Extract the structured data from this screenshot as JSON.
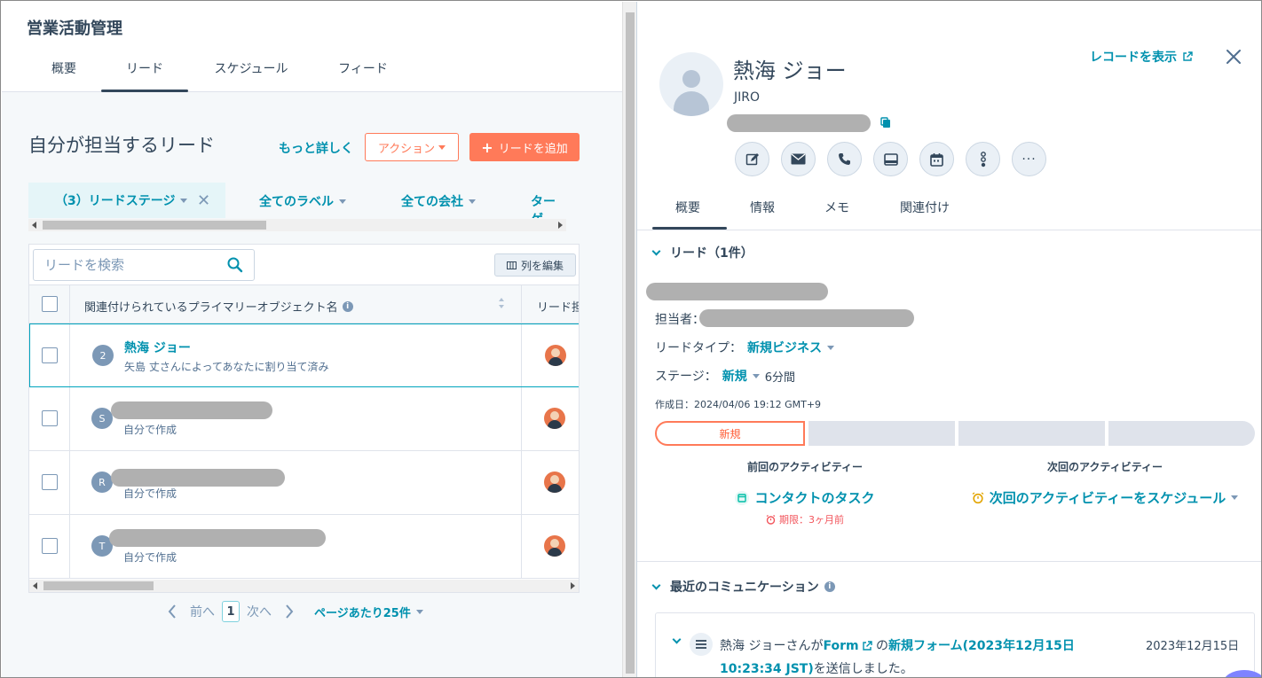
{
  "app": {
    "title": "営業活動管理"
  },
  "tabs": [
    "概要",
    "リード",
    "スケジュール",
    "フィード"
  ],
  "list": {
    "view_title": "自分が担当するリード",
    "more_link": "もっと詳しく",
    "action_label": "アクション",
    "add_label": "リードを追加",
    "filters": {
      "stage": "（3）リードステージ",
      "labels": "全てのラベル",
      "companies": "全ての会社",
      "target": "ターゲ"
    },
    "search_placeholder": "リードを検索",
    "edit_columns": "列を編集",
    "col_name": "関連付けられているプライマリーオブジェクト名",
    "col_owner": "リード担",
    "rows": [
      {
        "initial": "2",
        "title": "熱海 ジョー",
        "subtitle": "矢島 丈さんによってあなたに割り当て済み"
      },
      {
        "initial": "S",
        "title": "",
        "subtitle": "自分で作成"
      },
      {
        "initial": "R",
        "title": "",
        "subtitle": "自分で作成"
      },
      {
        "initial": "T",
        "title": "",
        "subtitle": "自分で作成"
      }
    ],
    "pager": {
      "prev": "前へ",
      "page": "1",
      "next": "次へ",
      "per_page": "ページあたり25件"
    }
  },
  "record": {
    "name": "熱海 ジョー",
    "sub": "JIRO",
    "view_record": "レコードを表示",
    "tabs": [
      "概要",
      "情報",
      "メモ",
      "関連付け"
    ],
    "lead_section": "リード（1件）",
    "owner_label": "担当者：",
    "type_label": "リードタイプ：",
    "type_value": "新規ビジネス",
    "stage_label": "ステージ：",
    "stage_value": "新規",
    "stage_duration": "6分間",
    "created": "作成日：2024/04/06 19:12 GMT+9",
    "stage_current": "新規",
    "prev_activity_title": "前回のアクティビティー",
    "prev_activity_link": "コンタクトのタスク",
    "prev_activity_due": "期限：3ヶ月前",
    "next_activity_title": "次回のアクティビティー",
    "next_activity_link": "次回のアクティビティーをスケジュール",
    "comm_section": "最近のコミュニケーション",
    "comm": {
      "prefix": "熱海 ジョーさんが",
      "form": "Form",
      "mid": "の",
      "form_name": "新規フォーム(2023年12月15日 10:23:34 JST)",
      "suffix": "を送信しました。",
      "date": "2023年12月15日"
    }
  },
  "colors": {
    "accent": "#0091ae",
    "orange": "#ff7a59",
    "text": "#33475b"
  }
}
